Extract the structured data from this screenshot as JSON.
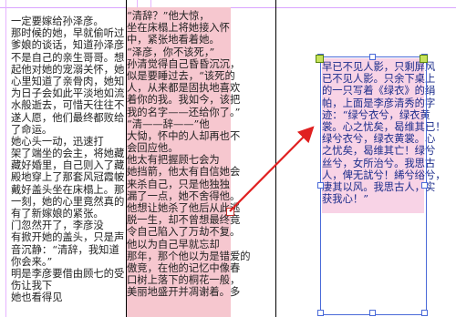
{
  "colors": {
    "highlight": "#f6c7cf",
    "arrow": "#e02020",
    "selection": "#4a6ad8",
    "linked_text": "#1a2b8a"
  },
  "left_column": {
    "lines": [
      "一定要嫁给孙泽彦。",
      "那时候的她，早就偷听过",
      "爹娘的谈话，知道孙泽彦",
      "不是自己的亲生哥哥。想",
      "起他对她的宠溺关怀，她",
      "心里知道了亲骨肉，她知",
      "为日子会如此平淡地如流",
      "水般逝去，可惜天往往不",
      "遂人愿，他们最终都败给",
      "了命运。",
      "她心头一动，迅速打",
      "架了端坐的会主，将她藏",
      "藏好婚里，自己则入了藏",
      "殿地穿上了那套风冠霞帔",
      "戴好盖头坐在床榻上。那",
      "一刻，她的心里竟然真的",
      "有了新嫁娘的紧张。",
      "门忽然开了，李彦没",
      "有掀开她的盖头，只是声",
      "音沉静：“清辞，我知道",
      "你会来。”",
      "明是李彦要借由顾七的受",
      "伤让我下",
      "她也看得见"
    ]
  },
  "middle_column": {
    "lines": [
      "“清辞？”他大惊，",
      "坐在床榻上将她接入怀",
      "中，紧张地看着她。",
      "“泽彦，你不该死，”",
      "孙清觉得自己昏昏沉沉，",
      "似是要睡过去，“该死的",
      "人，从来都是固执地喜欢",
      "着你的我。我如今，该把",
      "我的名字——还给你了。”",
      "“清——辞——”他",
      "大恸，怀中的人却再也不",
      "会回应他。",
      "他太有把握顾七会为",
      "她挡箭，他太有自信她会",
      "来杀自己，只是他独独",
      "漏了一点，她不舍得他。",
      "他想让她杀了他后从此逃",
      "脱一生，却不曾想最终竟",
      "令自己陷入了万劫不复。",
      "他以为自己早就忘却",
      "那年，那个他以为是错爱的",
      "傲竞，在他的记忆中像春",
      "口树上落下的桐花一般，",
      "美丽地盛开并凋谢着。多"
    ]
  },
  "linked_frame": {
    "lines": [
      "早已不见人影，只剩屏风",
      "已不见人影。只余下桌上",
      "的一只写着《绿衣》的绢",
      "帕，上面是李彦清秀的字",
      "迹：“绿兮衣兮，绿衣黄",
      "裳。心之忧矣，曷维其已！",
      "绿兮衣兮，绿衣黄裳。心",
      "之忧矣，曷维其亡！绿兮",
      "丝兮，女所治兮。我思古",
      "人，俾无訧兮！絺兮绤兮，",
      "凄其以风。我思古人，实",
      "获我心！”"
    ]
  }
}
